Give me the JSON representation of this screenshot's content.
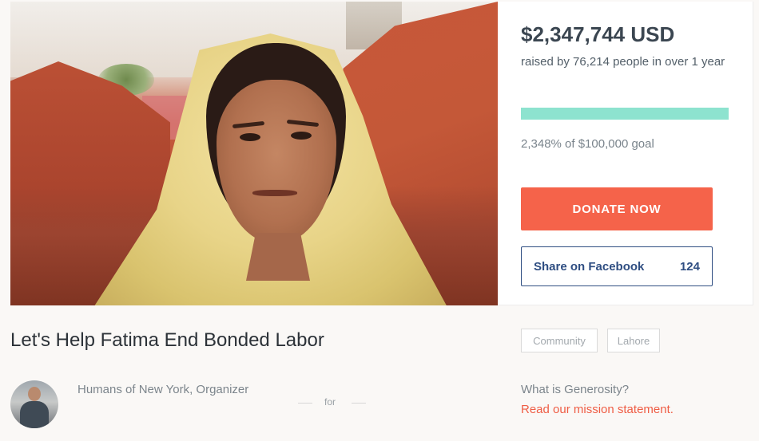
{
  "campaign": {
    "title": "Let's Help Fatima End Bonded Labor",
    "tags": [
      "Community",
      "Lahore"
    ]
  },
  "donation": {
    "amount": "$2,347,744 USD",
    "raised_text": "raised by 76,214 people in over 1 year",
    "goal_text": "2,348% of $100,000 goal",
    "progress_fraction": 1.0,
    "donate_label": "DONATE NOW",
    "share_label": "Share on Facebook",
    "share_count": "124",
    "colors": {
      "accent": "#f5634a",
      "progress": "#8de3cf",
      "facebook": "#2f4e82"
    }
  },
  "organizer": {
    "name": "Humans of New York, Organizer",
    "for_text": "for"
  },
  "generosity": {
    "question": "What is Generosity?",
    "link": "Read our mission statement."
  }
}
